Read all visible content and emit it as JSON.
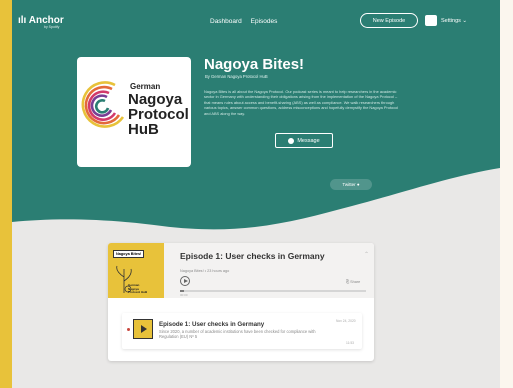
{
  "colors": {
    "teal": "#2b7e73",
    "yellow": "#e8c23a",
    "panel": "#e9e8e7"
  },
  "nav": {
    "logo": "ılı Anchor",
    "logo_sub": "by Spotify",
    "links": [
      "Dashboard",
      "Episodes"
    ],
    "new_episode": "New Episode",
    "settings": "Settings ⌄"
  },
  "cover": {
    "line1": "German",
    "line2": "Nagoya",
    "line3": "Protocol",
    "line4": "HuB"
  },
  "show": {
    "title": "Nagoya Bites!",
    "subtitle": "By German Nagoya Protocol HuB",
    "description": "Nagoya Bites is all about the Nagoya Protocol. Our podcast series is meant to help researchers in the academic sector in Germany with understanding their obligations arising from the implementation of the Nagoya Protocol – that means rules about access and benefit-sharing (ABS) as well as compliance. We walk researchers through various topics, answer common questions, address misconceptions and hopefully demystify the Nagoya Protocol and ABS along the way.",
    "message_button": "Message",
    "twitter_button": "Twitter"
  },
  "player": {
    "thumb_label": "Nagoya Bites!",
    "thumb_logo_lines": [
      "German",
      "Nagoya",
      "Protocol HuB"
    ],
    "title": "Episode 1: User checks in Germany",
    "meta": "Nagoya Bites! • 23 hours ago",
    "share": "Share",
    "elapsed": "00:00",
    "progress_fraction": 0.02
  },
  "episodes": [
    {
      "title": "Episode 1: User checks in Germany",
      "description": "Since 2020, a number of academic institutions have been checked for compliance with Regulation (EU) Nº 5",
      "date": "Nov 24, 2020",
      "duration": "11:53"
    }
  ]
}
